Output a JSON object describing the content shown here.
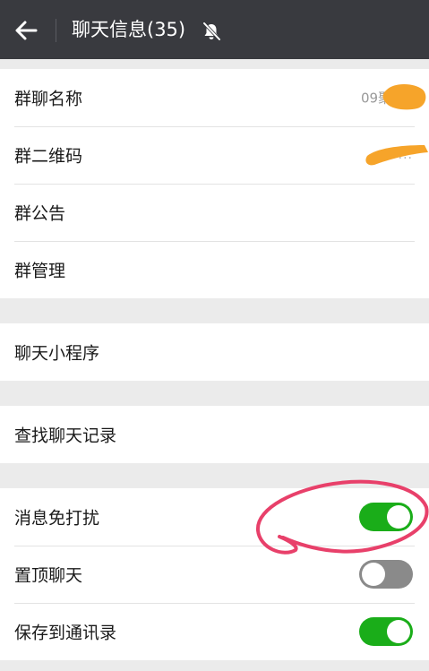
{
  "header": {
    "back_icon": "arrow-left-icon",
    "title": "聊天信息(35)",
    "mute_icon": "bell-off-icon"
  },
  "groups": [
    {
      "items": [
        {
          "label": "群聊名称",
          "value": "09聚"
        },
        {
          "label": "群二维码",
          "value": "..."
        },
        {
          "label": "群公告"
        },
        {
          "label": "群管理"
        }
      ]
    },
    {
      "items": [
        {
          "label": "聊天小程序"
        }
      ]
    },
    {
      "items": [
        {
          "label": "查找聊天记录"
        }
      ]
    },
    {
      "items": [
        {
          "label": "消息免打扰",
          "toggle": "on"
        },
        {
          "label": "置顶聊天",
          "toggle": "off"
        },
        {
          "label": "保存到通讯录",
          "toggle": "on"
        }
      ]
    }
  ],
  "colors": {
    "header_bg": "#393a3f",
    "toggle_on": "#1aad19",
    "toggle_off": "#8a8a8a",
    "redaction": "#f6a42a",
    "annotation": "#e8406a"
  }
}
